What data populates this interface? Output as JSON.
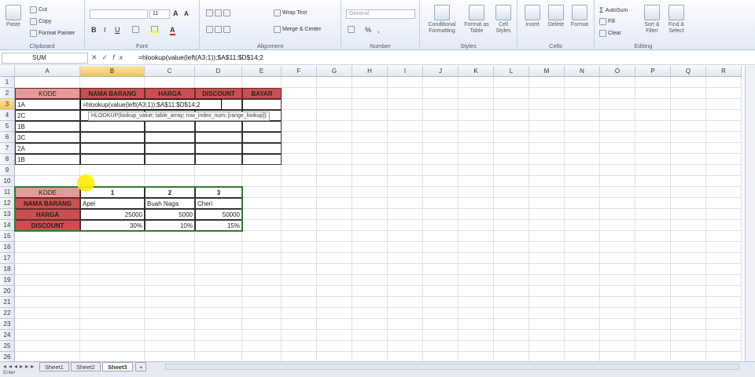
{
  "ribbon": {
    "paste": "Paste",
    "cut": "Cut",
    "copy": "Copy",
    "format_painter": "Format Painter",
    "clipboard": "Clipboard",
    "font_size": "11",
    "font_label": "Font",
    "wrap_text": "Wrap Text",
    "merge_center": "Merge & Center",
    "alignment": "Alignment",
    "number_format": "General",
    "number": "Number",
    "conditional_formatting": "Conditional Formatting",
    "format_as_table": "Format as Table",
    "cell_styles": "Cell Styles",
    "styles": "Styles",
    "insert": "Insert",
    "delete": "Delete",
    "format": "Format",
    "cells": "Cells",
    "autosum": "AutoSum",
    "fill": "Fill",
    "clear": "Clear",
    "sort_filter": "Sort & Filter",
    "find_select": "Find & Select",
    "editing": "Editing"
  },
  "formula_bar": {
    "name_box": "SUM",
    "formula": "=hlookup(value(left(A3;1));$A$11:$D$14;2"
  },
  "columns": [
    "A",
    "B",
    "C",
    "D",
    "E",
    "F",
    "G",
    "H",
    "I",
    "J",
    "K",
    "L",
    "M",
    "N",
    "O",
    "P",
    "Q",
    "R"
  ],
  "rows": [
    "1",
    "2",
    "3",
    "4",
    "5",
    "6",
    "7",
    "8",
    "9",
    "10",
    "11",
    "12",
    "13",
    "14",
    "15",
    "16",
    "17",
    "18",
    "19",
    "20",
    "21",
    "22",
    "23",
    "24",
    "25",
    "26"
  ],
  "table1": {
    "headers": [
      "KODE",
      "NAMA BARANG",
      "HARGA",
      "DISCOUNT",
      "BAYAR"
    ],
    "codes": [
      "1A",
      "2C",
      "1B",
      "3C",
      "2A",
      "1B"
    ],
    "editing_formula": "=hlookup(value(left(A3;1));$A$11:$D$14;2"
  },
  "tooltip": "HLOOKUP(lookup_value; table_array; row_index_num; [range_lookup])",
  "table2": {
    "row_labels": [
      "KODE",
      "NAMA BARANG",
      "HARGA",
      "DISCOUNT"
    ],
    "header": [
      "1",
      "2",
      "3"
    ],
    "names": [
      "Apel",
      "Buah Naga",
      "Cheri"
    ],
    "prices": [
      "25000",
      "5000",
      "50000"
    ],
    "discounts": [
      "30%",
      "10%",
      "15%"
    ]
  },
  "sheets": [
    "Sheet1",
    "Sheet2",
    "Sheet3"
  ],
  "active_sheet": "Sheet3",
  "status": "Enter"
}
